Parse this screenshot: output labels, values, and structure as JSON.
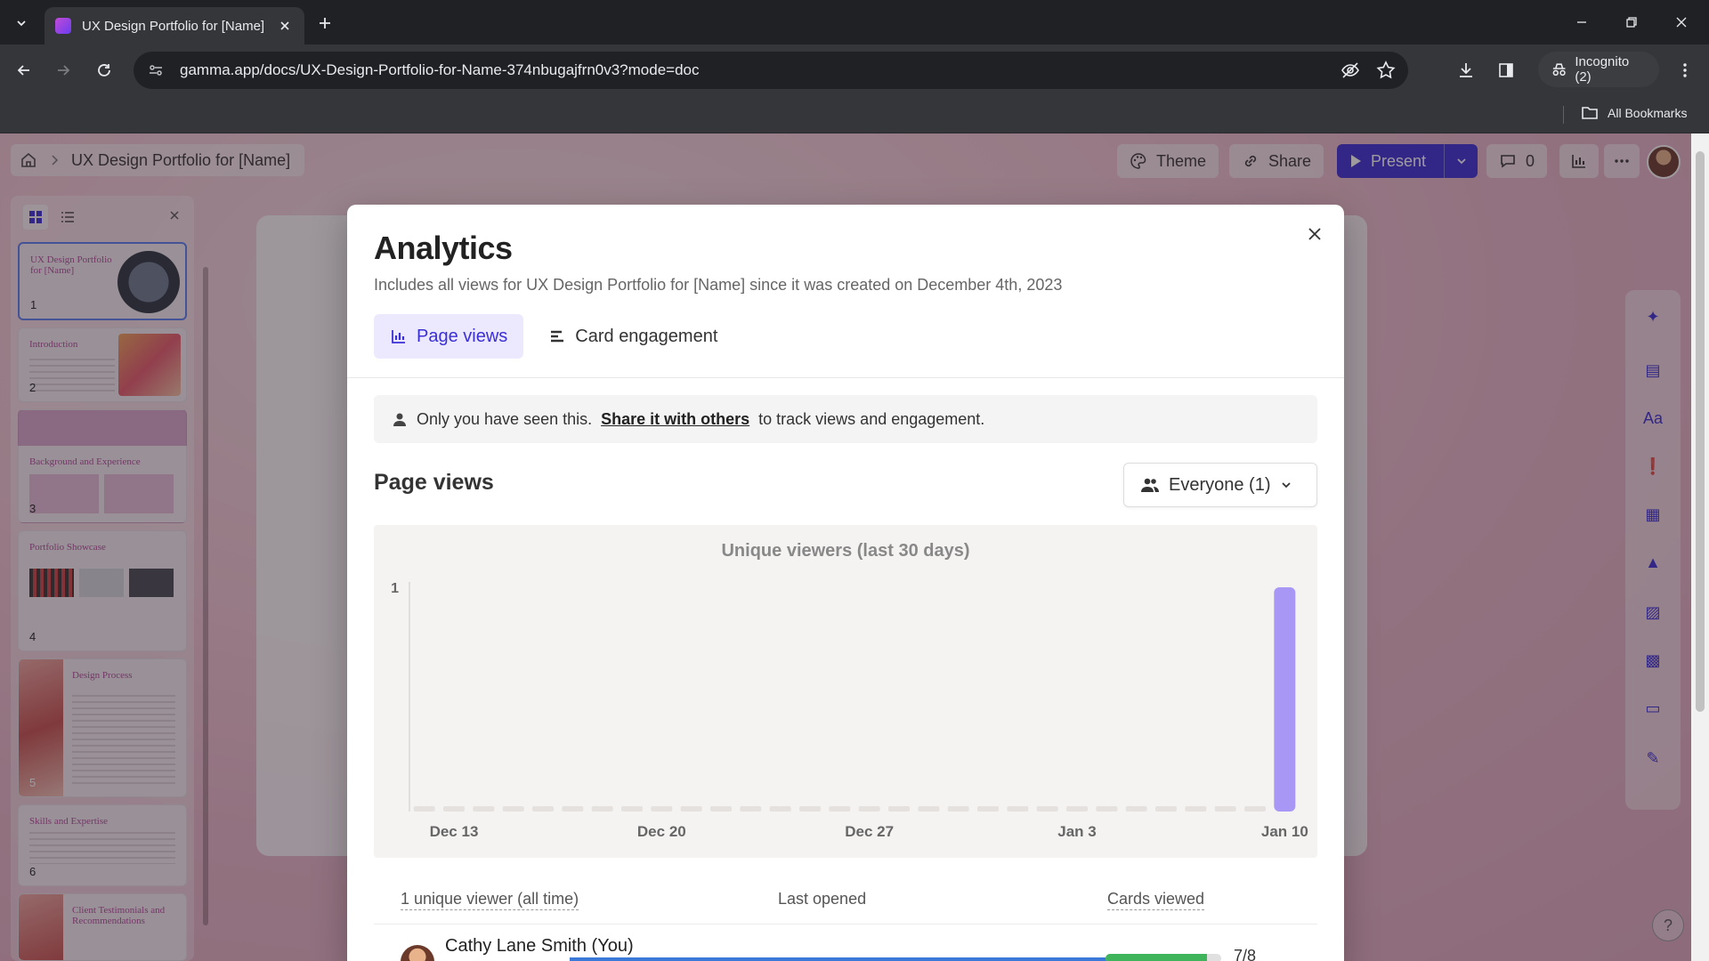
{
  "browser": {
    "tab_title": "UX Design Portfolio for [Name]",
    "url": "gamma.app/docs/UX-Design-Portfolio-for-Name-374nbugajfrn0v3?mode=doc",
    "incognito_label": "Incognito (2)",
    "bookmarks_label": "All Bookmarks"
  },
  "app": {
    "breadcrumb_title": "UX Design Portfolio for [Name]",
    "theme_label": "Theme",
    "share_label": "Share",
    "present_label": "Present",
    "comments_count": "0"
  },
  "sidebar": {
    "slides": [
      {
        "num": "1",
        "title": "UX Design Portfolio for [Name]"
      },
      {
        "num": "2",
        "title": "Introduction"
      },
      {
        "num": "3",
        "title": "Background and Experience"
      },
      {
        "num": "4",
        "title": "Portfolio Showcase"
      },
      {
        "num": "5",
        "title": "Design Process"
      },
      {
        "num": "6",
        "title": "Skills and Expertise"
      },
      {
        "num": "",
        "title": "Client Testimonials and Recommendations"
      }
    ]
  },
  "modal": {
    "title": "Analytics",
    "subtitle": "Includes all views for UX Design Portfolio for [Name] since it was created on December 4th, 2023",
    "tab_page_views": "Page views",
    "tab_card_engagement": "Card engagement",
    "notice_prefix": "Only you have seen this.",
    "notice_link": "Share it with others",
    "notice_suffix": "to track views and engagement.",
    "section_title": "Page views",
    "audience_select": "Everyone (1)",
    "table": {
      "col_viewers": "1 unique viewer (all time)",
      "col_last_opened": "Last opened",
      "col_cards_viewed": "Cards viewed",
      "rows": [
        {
          "name": "Cathy Lane Smith (You)",
          "cards_viewed": "7/8",
          "cards_fraction": 0.875
        }
      ]
    }
  },
  "chart_data": {
    "type": "bar",
    "title": "Unique viewers (last 30 days)",
    "x_tick_labels": [
      "Dec 13",
      "Dec 20",
      "Dec 27",
      "Jan 3",
      "Jan 10"
    ],
    "y_tick_labels": [
      "1"
    ],
    "ylim": [
      0,
      1
    ],
    "categories": [
      "Dec 12",
      "Dec 13",
      "Dec 14",
      "Dec 15",
      "Dec 16",
      "Dec 17",
      "Dec 18",
      "Dec 19",
      "Dec 20",
      "Dec 21",
      "Dec 22",
      "Dec 23",
      "Dec 24",
      "Dec 25",
      "Dec 26",
      "Dec 27",
      "Dec 28",
      "Dec 29",
      "Dec 30",
      "Dec 31",
      "Jan 1",
      "Jan 2",
      "Jan 3",
      "Jan 4",
      "Jan 5",
      "Jan 6",
      "Jan 7",
      "Jan 8",
      "Jan 9",
      "Jan 10"
    ],
    "values": [
      0,
      0,
      0,
      0,
      0,
      0,
      0,
      0,
      0,
      0,
      0,
      0,
      0,
      0,
      0,
      0,
      0,
      0,
      0,
      0,
      0,
      0,
      0,
      0,
      0,
      0,
      0,
      0,
      0,
      1
    ],
    "bar_color": "#a897f5",
    "empty_color": "#e4e1df",
    "grid": false
  },
  "colors": {
    "accent": "#3b2fd6",
    "accent_light": "#ece9ff"
  }
}
